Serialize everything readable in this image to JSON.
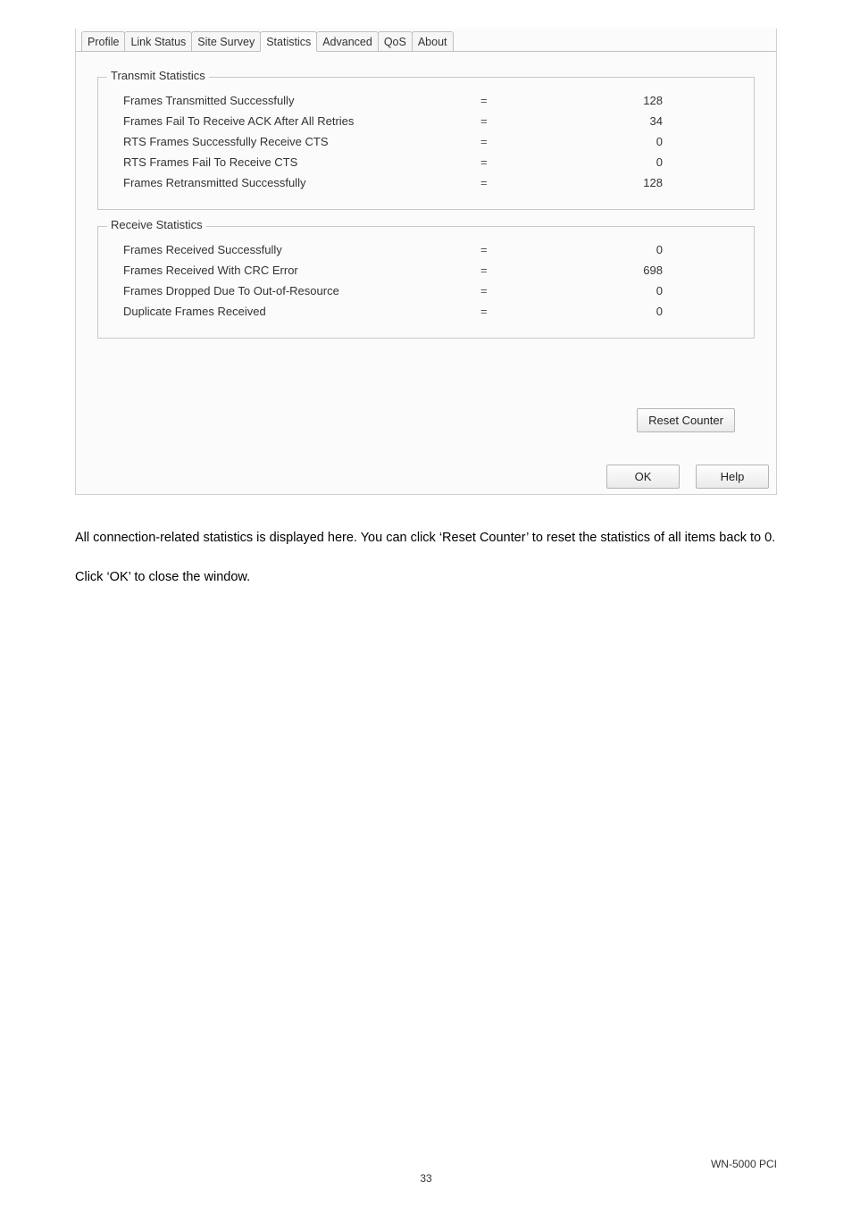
{
  "tabs": {
    "profile": "Profile",
    "link_status": "Link Status",
    "site_survey": "Site Survey",
    "statistics": "Statistics",
    "advanced": "Advanced",
    "qos": "QoS",
    "about": "About"
  },
  "transmit": {
    "legend": "Transmit Statistics",
    "rows": [
      {
        "label": "Frames Transmitted Successfully",
        "value": "128"
      },
      {
        "label": "Frames Fail To Receive ACK After All Retries",
        "value": "34"
      },
      {
        "label": "RTS Frames Successfully Receive CTS",
        "value": "0"
      },
      {
        "label": "RTS Frames Fail To Receive CTS",
        "value": "0"
      },
      {
        "label": "Frames Retransmitted Successfully",
        "value": "128"
      }
    ]
  },
  "receive": {
    "legend": "Receive Statistics",
    "rows": [
      {
        "label": "Frames Received Successfully",
        "value": "0"
      },
      {
        "label": "Frames Received With CRC Error",
        "value": "698"
      },
      {
        "label": "Frames Dropped Due To Out-of-Resource",
        "value": "0"
      },
      {
        "label": "Duplicate Frames Received",
        "value": "0"
      }
    ]
  },
  "buttons": {
    "reset": "Reset Counter",
    "ok": "OK",
    "help": "Help"
  },
  "doc": {
    "para1": "All connection-related statistics is displayed here. You can click ‘Reset Counter’ to reset the statistics of all items back to 0.",
    "para2": "Click ‘OK’ to close the window."
  },
  "footer": {
    "pagenum": "33",
    "model": "WN-5000 PCI"
  }
}
